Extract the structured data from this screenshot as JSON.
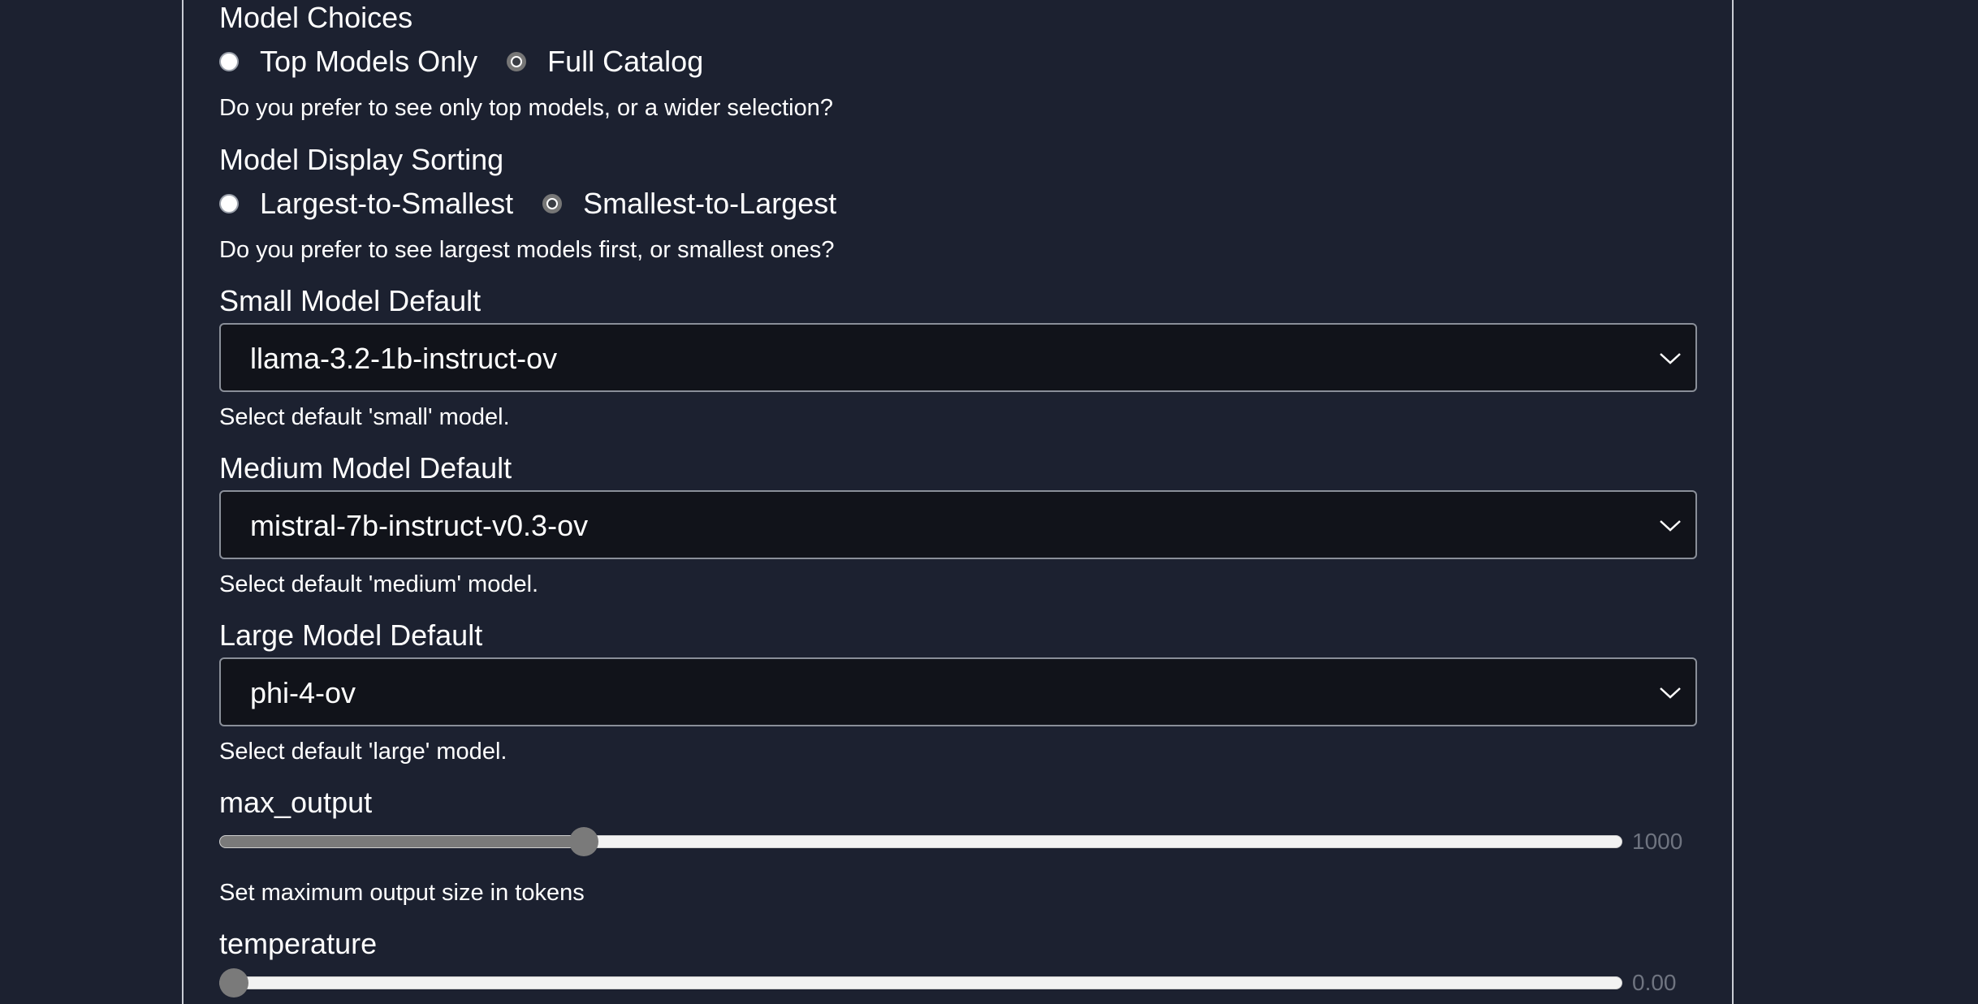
{
  "model_choices": {
    "label": "Model Choices",
    "options": [
      "Top Models Only",
      "Full Catalog"
    ],
    "selected": "Full Catalog",
    "help": "Do you prefer to see only top models, or a wider selection?"
  },
  "model_sorting": {
    "label": "Model Display Sorting",
    "options": [
      "Largest-to-Smallest",
      "Smallest-to-Largest"
    ],
    "selected": "Smallest-to-Largest",
    "help": "Do you prefer to see largest models first, or smallest ones?"
  },
  "small_model": {
    "label": "Small Model Default",
    "value": "llama-3.2-1b-instruct-ov",
    "help": "Select default 'small' model."
  },
  "medium_model": {
    "label": "Medium Model Default",
    "value": "mistral-7b-instruct-v0.3-ov",
    "help": "Select default 'medium' model."
  },
  "large_model": {
    "label": "Large Model Default",
    "value": "phi-4-ov",
    "help": "Select default 'large' model."
  },
  "max_output": {
    "label": "max_output",
    "value_text": "1000",
    "fill_fraction": 0.255,
    "help": "Set maximum output size in tokens"
  },
  "temperature": {
    "label": "temperature",
    "value_text": "0.00",
    "fill_fraction": 0.0
  },
  "colors": {
    "background": "#1c2130",
    "select_background": "#11131a",
    "slider_fill": "#7a7a7a",
    "slider_value_text": "#6f7480"
  }
}
